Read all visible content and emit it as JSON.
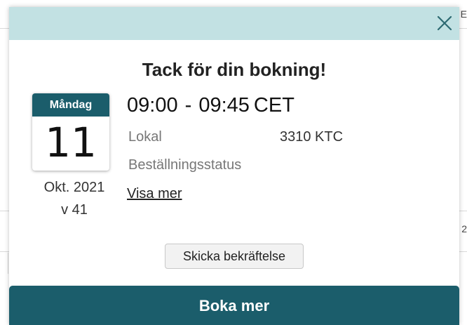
{
  "background": {
    "edge_glyph_top": "E",
    "edge_glyph_mid": "2"
  },
  "modal": {
    "close_icon": "close-icon",
    "title": "Tack för din bokning!",
    "calendar": {
      "weekday": "Måndag",
      "day": "11",
      "month_year": "Okt. 2021",
      "week": "v 41"
    },
    "booking": {
      "time_range": "09:00 - 09:45",
      "timezone": "CET",
      "lokal_label": "Lokal",
      "lokal_value": "3310 KTC",
      "status_label": "Beställningsstatus",
      "show_more_label": "Visa mer"
    },
    "confirm_button_label": "Skicka bekräftelse",
    "book_more_label": "Boka mer"
  },
  "colors": {
    "header_bg": "#c2e1e3",
    "accent": "#1b5d6b"
  }
}
